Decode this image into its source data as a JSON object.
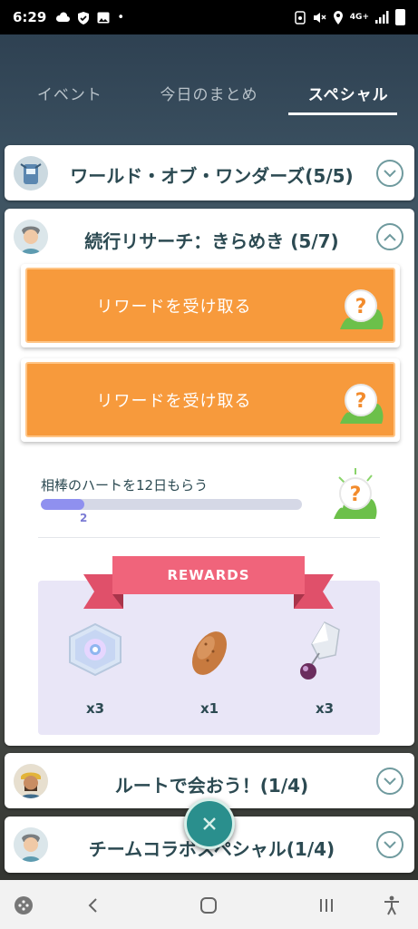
{
  "status_bar": {
    "time": "6:29",
    "network_label": "4G+"
  },
  "tabs": [
    {
      "label": "イベント",
      "active": false
    },
    {
      "label": "今日のまとめ",
      "active": false
    },
    {
      "label": "スペシャル",
      "active": true
    }
  ],
  "cards": {
    "wonders": {
      "title": "ワールド・オブ・ワンダーズ(5/5)",
      "expanded": false
    },
    "research": {
      "title": "続行リサーチ：きらめき (5/7)",
      "expanded": true,
      "claim_buttons": [
        {
          "label": "リワードを受け取る"
        },
        {
          "label": "リワードを受け取る"
        }
      ],
      "task": {
        "text": "相棒のハートを12日もらう",
        "progress_value": 2,
        "progress_total": 12,
        "progress_label": "2"
      },
      "rewards": {
        "banner": "REWARDS",
        "items": [
          {
            "name": "Field hex item",
            "qty": "x3"
          },
          {
            "name": "Brown bean item",
            "qty": "x1"
          },
          {
            "name": "Crystal item",
            "qty": "x3"
          }
        ]
      }
    },
    "route": {
      "title": "ルートで会おう！(1/4)",
      "expanded": false
    },
    "team": {
      "title": "チームコラボスペシャル(1/4)",
      "expanded": false
    }
  },
  "colors": {
    "accent": "#f79a3c",
    "title_text": "#2c4a52",
    "progress": "#8f90ef",
    "ribbon": "#f0647b",
    "fab": "#2a8f8d"
  }
}
